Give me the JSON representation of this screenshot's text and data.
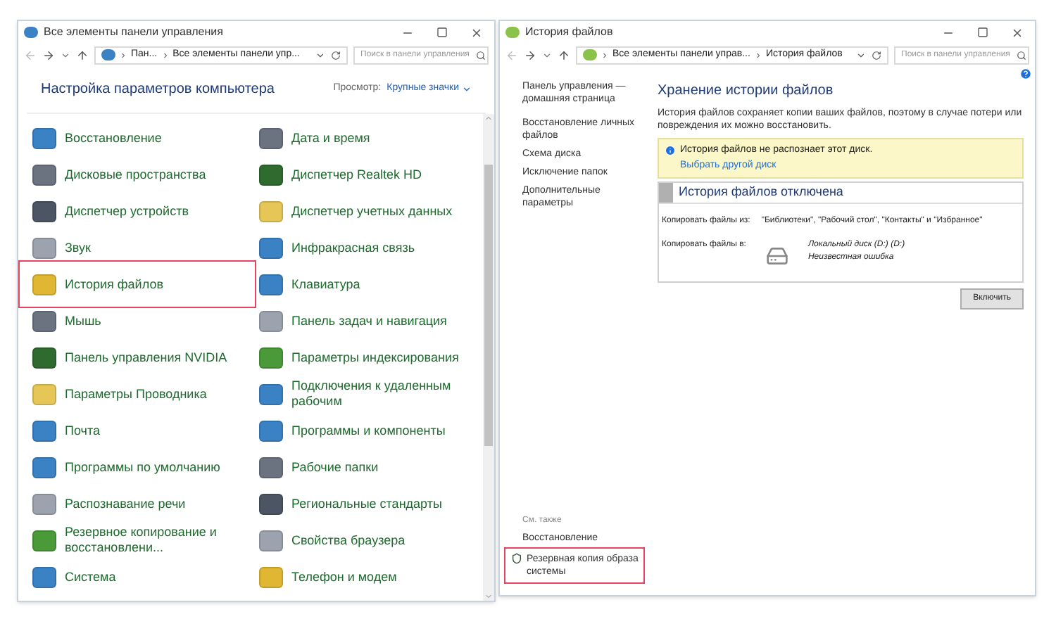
{
  "left_window": {
    "title": "Все элементы панели управления",
    "breadcrumb": [
      "Пан...",
      "Все элементы панели упр..."
    ],
    "search": {
      "placeholder": "Поиск в панели управления"
    },
    "heading": "Настройка параметров компьютера",
    "view_label": "Просмотр:",
    "view_value": "Крупные значки",
    "columns": [
      [
        {
          "label": "Восстановление",
          "highlighted": false
        },
        {
          "label": "Дисковые пространства",
          "highlighted": false
        },
        {
          "label": "Диспетчер устройств",
          "highlighted": false
        },
        {
          "label": "Звук",
          "highlighted": false
        },
        {
          "label": "История файлов",
          "highlighted": true
        },
        {
          "label": "Мышь",
          "highlighted": false
        },
        {
          "label": "Панель управления NVIDIA",
          "highlighted": false
        },
        {
          "label": "Параметры Проводника",
          "highlighted": false
        },
        {
          "label": "Почта",
          "highlighted": false
        },
        {
          "label": "Программы по умолчанию",
          "highlighted": false
        },
        {
          "label": "Распознавание речи",
          "highlighted": false
        },
        {
          "label": "Резервное копирование и восстановлени...",
          "highlighted": false
        },
        {
          "label": "Система",
          "highlighted": false
        }
      ],
      [
        {
          "label": "Дата и время",
          "highlighted": false
        },
        {
          "label": "Диспетчер Realtek HD",
          "highlighted": false
        },
        {
          "label": "Диспетчер учетных данных",
          "highlighted": false
        },
        {
          "label": "Инфракрасная связь",
          "highlighted": false
        },
        {
          "label": "Клавиатура",
          "highlighted": false
        },
        {
          "label": "Панель задач и навигация",
          "highlighted": false
        },
        {
          "label": "Параметры индексирования",
          "highlighted": false
        },
        {
          "label": "Подключения к удаленным рабочим",
          "highlighted": false
        },
        {
          "label": "Программы и компоненты",
          "highlighted": false
        },
        {
          "label": "Рабочие папки",
          "highlighted": false
        },
        {
          "label": "Региональные стандарты",
          "highlighted": false
        },
        {
          "label": "Свойства браузера",
          "highlighted": false
        },
        {
          "label": "Телефон и модем",
          "highlighted": false
        }
      ]
    ]
  },
  "right_window": {
    "title": "История файлов",
    "breadcrumb": [
      "Все элементы панели управ...",
      "История файлов"
    ],
    "search": {
      "placeholder": "Поиск в панели управления"
    },
    "sidebar": [
      "Панель управления — домашняя страница",
      "Восстановление личных файлов",
      "Схема диска",
      "Исключение папок",
      "Дополнительные параметры"
    ],
    "heading": "Хранение истории файлов",
    "description": "История файлов сохраняет копии ваших файлов, поэтому в случае потери или повреждения их можно восстановить.",
    "notice": {
      "text": "История файлов не распознает этот диск.",
      "link": "Выбрать другой диск"
    },
    "status_title": "История файлов отключена",
    "copy_from": {
      "label": "Копировать файлы из:",
      "value": "\"Библиотеки\", \"Рабочий стол\", \"Контакты\" и \"Избранное\""
    },
    "copy_to": {
      "label": "Копировать файлы в:",
      "drive": "Локальный диск (D:) (D:)",
      "status": "Неизвестная ошибка"
    },
    "button": "Включить",
    "see_also": {
      "title": "См. также",
      "links": [
        {
          "label": "Восстановление",
          "kind": "plain",
          "highlighted": false
        },
        {
          "label": "Резервная копия образа системы",
          "kind": "shield",
          "highlighted": true
        }
      ]
    }
  }
}
